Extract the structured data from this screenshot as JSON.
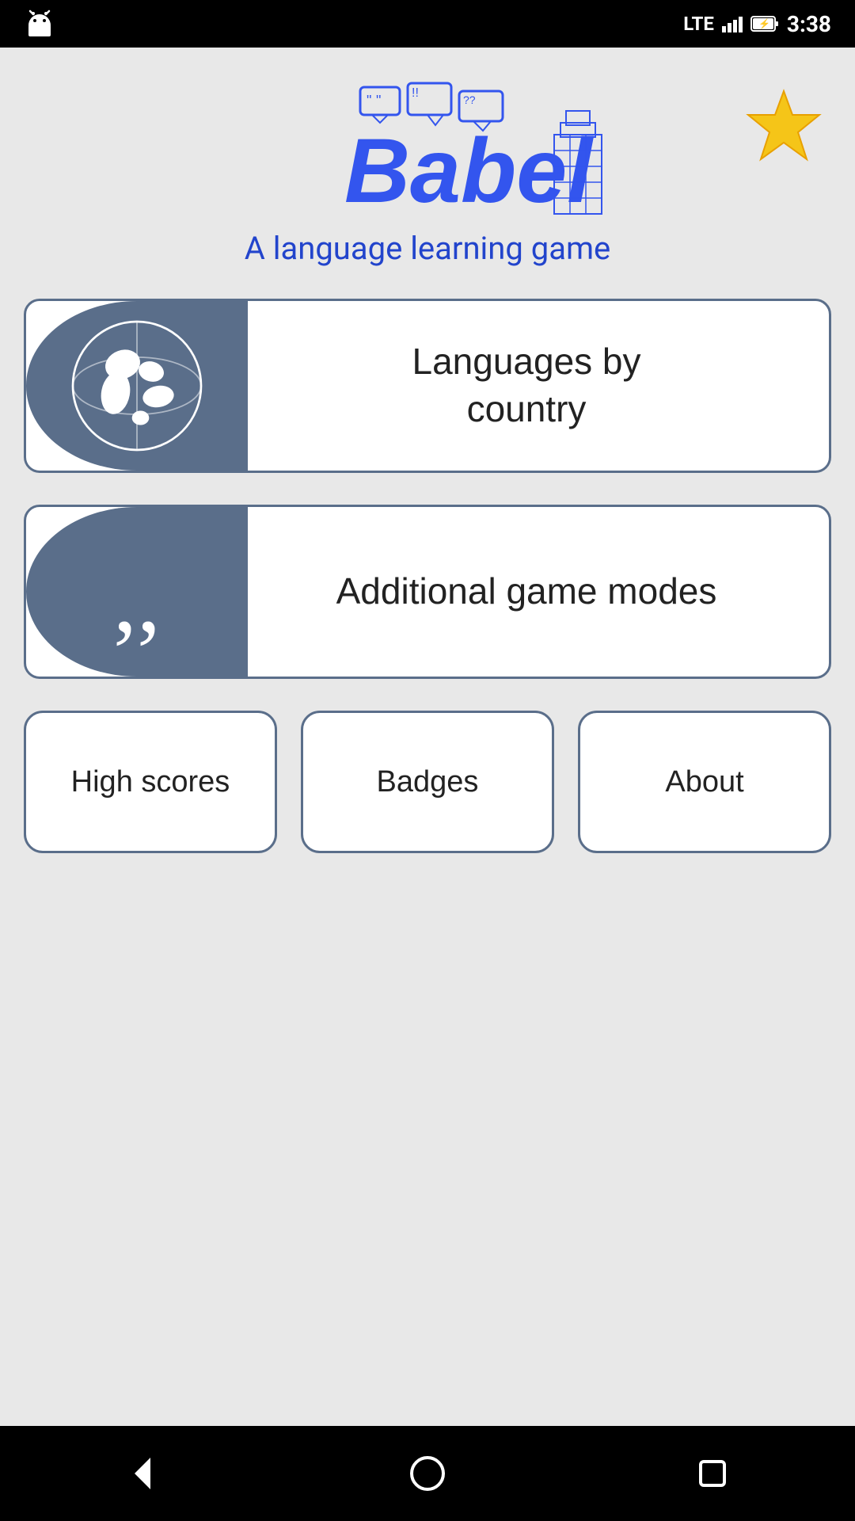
{
  "statusBar": {
    "time": "3:38",
    "network": "LTE"
  },
  "header": {
    "logoText": "Babel",
    "subtitle": "A language learning game",
    "starLabel": "Favorites"
  },
  "gameModes": [
    {
      "id": "languages-by-country",
      "label": "Languages by\ncountry",
      "icon": "globe-icon"
    },
    {
      "id": "additional-game-modes",
      "label": "Additional game modes",
      "icon": "quote-icon"
    }
  ],
  "bottomButtons": [
    {
      "id": "high-scores",
      "label": "High scores"
    },
    {
      "id": "badges",
      "label": "Badges"
    },
    {
      "id": "about",
      "label": "About"
    }
  ],
  "navBar": {
    "back": "back-icon",
    "home": "home-icon",
    "recents": "recents-icon"
  }
}
